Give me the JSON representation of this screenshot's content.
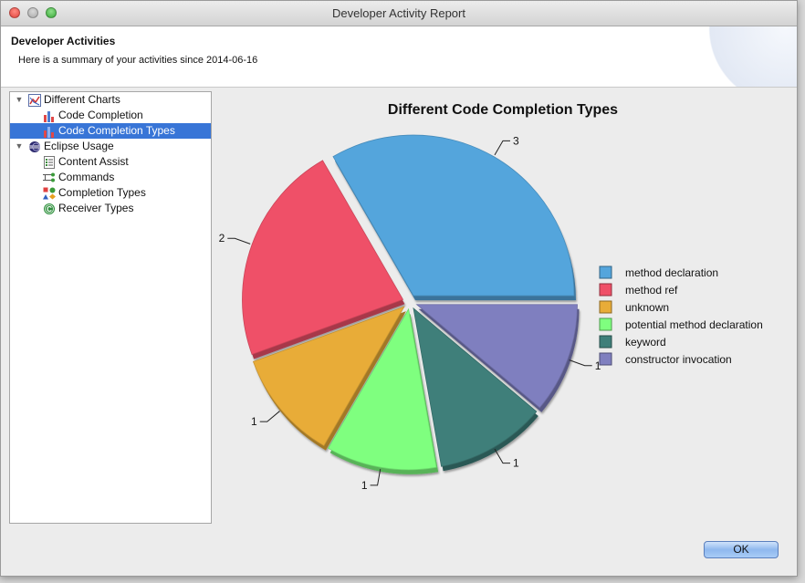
{
  "window": {
    "title": "Developer Activity Report"
  },
  "header": {
    "title": "Developer Activities",
    "subtitle": "Here is a summary of your activities since 2014-06-16"
  },
  "tree": {
    "items": [
      {
        "label": "Different Charts",
        "icon": "charts-icon",
        "expanded": true,
        "level": 0,
        "selected": false
      },
      {
        "label": "Code Completion",
        "icon": "bar-chart-icon",
        "level": 1,
        "selected": false
      },
      {
        "label": "Code Completion Types",
        "icon": "bar-chart-icon",
        "level": 1,
        "selected": true
      },
      {
        "label": "Eclipse Usage",
        "icon": "eclipse-icon",
        "expanded": true,
        "level": 0,
        "selected": false
      },
      {
        "label": "Content Assist",
        "icon": "list-icon",
        "level": 1,
        "selected": false
      },
      {
        "label": "Commands",
        "icon": "commands-icon",
        "level": 1,
        "selected": false
      },
      {
        "label": "Completion Types",
        "icon": "shapes-icon",
        "level": 1,
        "selected": false
      },
      {
        "label": "Receiver Types",
        "icon": "receiver-icon",
        "level": 1,
        "selected": false
      }
    ]
  },
  "buttons": {
    "ok": "OK"
  },
  "chart_data": {
    "type": "pie",
    "title": "Different Code Completion Types",
    "legend_position": "right",
    "slices": [
      {
        "name": "method declaration",
        "value": 3,
        "label": "3",
        "color": "#54a5dc"
      },
      {
        "name": "method ref",
        "value": 2,
        "label": "2",
        "color": "#ef5068"
      },
      {
        "name": "unknown",
        "value": 1,
        "label": "1",
        "color": "#e8ac38"
      },
      {
        "name": "potential method declaration",
        "value": 1,
        "label": "1",
        "color": "#7fff7f"
      },
      {
        "name": "keyword",
        "value": 1,
        "label": "1",
        "color": "#3f7f7a"
      },
      {
        "name": "constructor invocation",
        "value": 1,
        "label": "1",
        "color": "#7f7fbf"
      }
    ]
  }
}
